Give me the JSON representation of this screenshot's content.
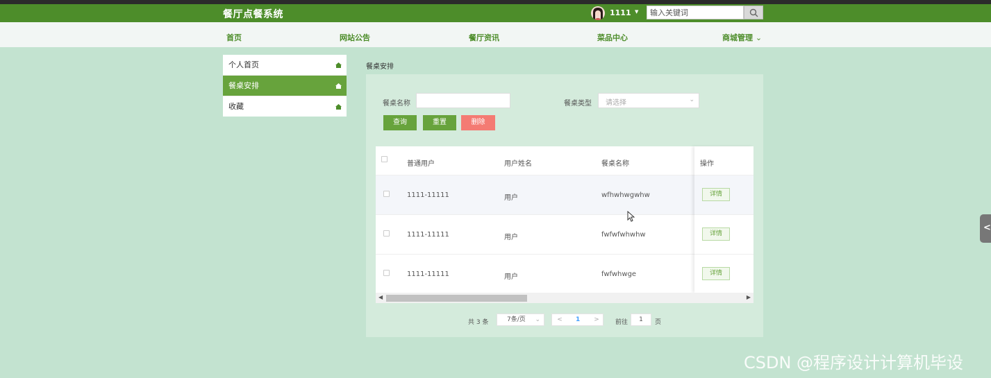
{
  "header": {
    "brand": "餐厅点餐系统",
    "username": "1111",
    "search_placeholder": "输入关键词"
  },
  "nav": {
    "items": [
      "首页",
      "网站公告",
      "餐厅资讯",
      "菜品中心",
      "商城管理"
    ]
  },
  "sidebar": {
    "items": [
      {
        "label": "个人首页",
        "active": false
      },
      {
        "label": "餐桌安排",
        "active": true
      },
      {
        "label": "收藏",
        "active": false
      }
    ]
  },
  "page": {
    "title": "餐桌安排",
    "filters": {
      "name_label": "餐桌名称",
      "type_label": "餐桌类型",
      "type_placeholder": "请选择"
    },
    "buttons": {
      "query": "查询",
      "reset": "重置",
      "delete": "删除"
    },
    "table": {
      "columns": [
        "普通用户",
        "用户姓名",
        "餐桌名称",
        "操作"
      ],
      "rows": [
        {
          "user": "1111-11111",
          "name": "用户",
          "table_name": "wfhwhwgwhw",
          "action": "详情"
        },
        {
          "user": "1111-11111",
          "name": "用户",
          "table_name": "fwfwfwhwhw",
          "action": "详情"
        },
        {
          "user": "1111-11111",
          "name": "用户",
          "table_name": "fwfwhwge",
          "action": "详情"
        }
      ]
    },
    "pagination": {
      "total": "共 3 条",
      "page_size": "7条/页",
      "current_page": "1",
      "goto_label": "前往",
      "goto_value": "1",
      "page_unit": "页"
    }
  },
  "watermark": "CSDN @程序设计计算机毕设",
  "colors": {
    "primary": "#4d8d2a",
    "accent": "#67a33c",
    "danger": "#f47b73",
    "background": "#c3e3d0"
  }
}
